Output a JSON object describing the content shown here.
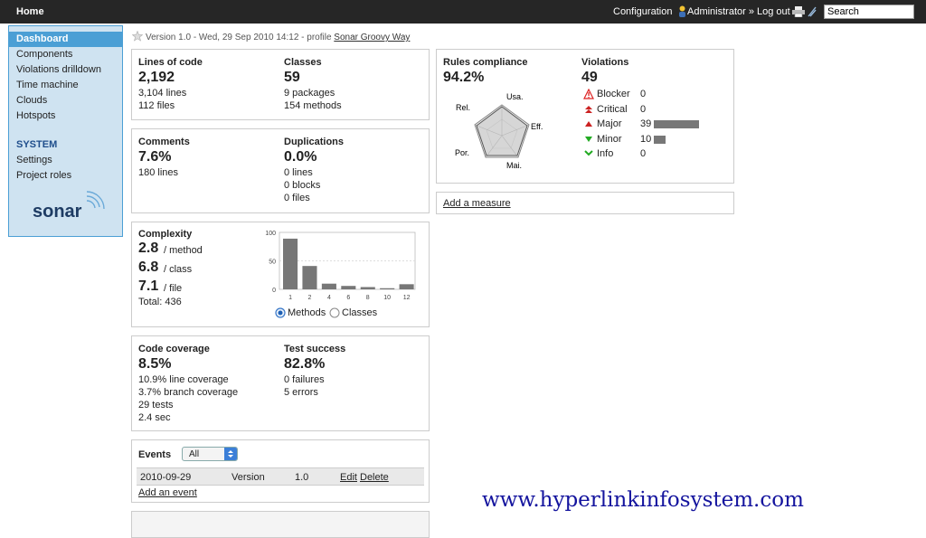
{
  "topbar": {
    "home": "Home",
    "configuration": "Configuration",
    "admin": "Administrator » Log out",
    "search_value": "Search"
  },
  "sidebar": {
    "items": [
      {
        "label": "Dashboard",
        "active": true
      },
      {
        "label": "Components"
      },
      {
        "label": "Violations drilldown"
      },
      {
        "label": "Time machine"
      },
      {
        "label": "Clouds"
      },
      {
        "label": "Hotspots"
      }
    ],
    "section": "SYSTEM",
    "system_items": [
      {
        "label": "Settings"
      },
      {
        "label": "Project roles"
      }
    ],
    "logo": "sonar"
  },
  "header": {
    "version": "Version 1.0 - Wed, 29 Sep 2010 14:12 - profile",
    "profile": "Sonar Groovy Way"
  },
  "size": {
    "loc_title": "Lines of code",
    "loc_value": "2,192",
    "loc_lines": "3,104 lines",
    "loc_files": "112 files",
    "classes_title": "Classes",
    "classes_value": "59",
    "classes_packages": "9 packages",
    "classes_methods": "154 methods"
  },
  "comments": {
    "title": "Comments",
    "value": "7.6%",
    "lines": "180 lines",
    "dup_title": "Duplications",
    "dup_value": "0.0%",
    "dup_lines": "0 lines",
    "dup_blocks": "0 blocks",
    "dup_files": "0 files"
  },
  "complexity": {
    "title": "Complexity",
    "method_value": "2.8",
    "method_label": "/ method",
    "class_value": "6.8",
    "class_label": "/ class",
    "file_value": "7.1",
    "file_label": "/ file",
    "total": "Total: 436",
    "radio_methods": "Methods",
    "radio_classes": "Classes",
    "selected": "Methods"
  },
  "chart_data": {
    "type": "bar",
    "categories": [
      "1",
      "2",
      "4",
      "6",
      "8",
      "10",
      "12"
    ],
    "values": [
      89,
      41,
      10,
      6,
      4,
      2,
      9
    ],
    "ylim": [
      0,
      100
    ],
    "yticks": [
      "100",
      "50",
      "0"
    ],
    "grid": true
  },
  "coverage": {
    "title": "Code coverage",
    "value": "8.5%",
    "line": "10.9% line coverage",
    "branch": "3.7% branch coverage",
    "tests": "29 tests",
    "time": "2.4 sec",
    "ts_title": "Test success",
    "ts_value": "82.8%",
    "ts_failures": "0 failures",
    "ts_errors": "5 errors"
  },
  "events": {
    "title": "Events",
    "filter": "All",
    "row": {
      "date": "2010-09-29",
      "category": "Version",
      "name": "1.0",
      "edit": "Edit",
      "delete": "Delete"
    },
    "add": "Add an event"
  },
  "rules": {
    "title": "Rules compliance",
    "value": "94.2%",
    "axes": [
      "Usa.",
      "Eff.",
      "Mai.",
      "Por.",
      "Rel."
    ]
  },
  "violations": {
    "title": "Violations",
    "value": "49",
    "rows": [
      {
        "label": "Blocker",
        "count": "0",
        "color": "#d22"
      },
      {
        "label": "Critical",
        "count": "0",
        "color": "#d22"
      },
      {
        "label": "Major",
        "count": "39",
        "color": "#d22"
      },
      {
        "label": "Minor",
        "count": "10",
        "color": "#2a2"
      },
      {
        "label": "Info",
        "count": "0",
        "color": "#2a2"
      }
    ],
    "bar_values": [
      0,
      0,
      39,
      10,
      0
    ],
    "bar_max": 39
  },
  "add_measure": "Add a measure",
  "watermark": "www.hyperlinkinfosystem.com"
}
